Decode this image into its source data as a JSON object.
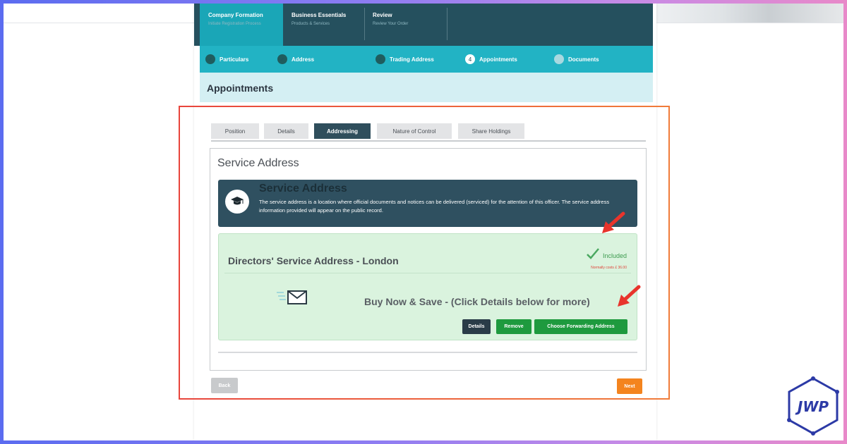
{
  "steps": [
    {
      "title": "Company Formation",
      "subtitle": "Initiate Registration Process"
    },
    {
      "title": "Business Essentials",
      "subtitle": "Products & Services"
    },
    {
      "title": "Review",
      "subtitle": "Review Your Order"
    }
  ],
  "substeps": [
    {
      "label": "Particulars",
      "marker": "✓"
    },
    {
      "label": "Address",
      "marker": "✓"
    },
    {
      "label": "Trading Address",
      "marker": "✓"
    },
    {
      "label": "Appointments",
      "marker": "4"
    },
    {
      "label": "Documents",
      "marker": ""
    }
  ],
  "page": {
    "title": "Appointments"
  },
  "tabs": [
    {
      "label": "Position"
    },
    {
      "label": "Details"
    },
    {
      "label": "Addressing"
    },
    {
      "label": "Nature of Control"
    },
    {
      "label": "Share Holdings"
    }
  ],
  "card": {
    "title": "Service Address",
    "info_heading": "Service Address",
    "info_text": "The service address is a location where official documents and notices can be delivered (serviced) for the attention of this officer. The service address information provided will appear on the public record.",
    "product_name": "Directors' Service Address - London",
    "status_label": "Included",
    "status_note": "Normally costs £ 36.00",
    "promo": "Buy Now & Save - (Click Details below for more)",
    "details_button": "Details",
    "remove_button": "Remove",
    "forward_button": "Choose Forwarding Address"
  },
  "nav": {
    "back": "Back",
    "next": "Next"
  },
  "logo": {
    "text": "JWP"
  },
  "colors": {
    "header_dark": "#25505e",
    "header_teal": "#22b3c4",
    "accent_green": "#1e9a3e",
    "next_orange": "#f4841e",
    "highlight_red": "#e8453c"
  }
}
